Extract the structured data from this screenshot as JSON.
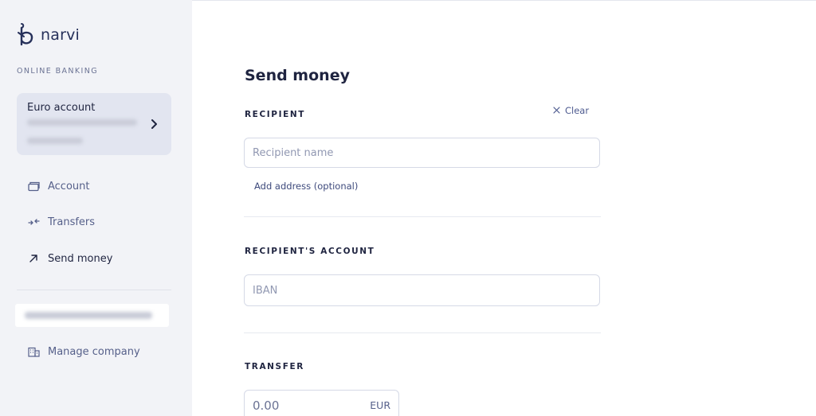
{
  "brand": {
    "name": "narvi"
  },
  "sidebar": {
    "section_label": "ONLINE BANKING",
    "account_card": {
      "name": "Euro account"
    },
    "nav": [
      {
        "label": "Account",
        "icon": "wallet-icon"
      },
      {
        "label": "Transfers",
        "icon": "transfer-arrows-icon"
      },
      {
        "label": "Send money",
        "icon": "arrow-up-right-icon"
      }
    ],
    "manage": {
      "label": "Manage company",
      "icon": "building-icon"
    }
  },
  "main": {
    "title": "Send money",
    "recipient": {
      "label": "RECIPIENT",
      "clear_label": "Clear",
      "name_placeholder": "Recipient name",
      "add_address_label": "Add address (optional)"
    },
    "recipient_account": {
      "label": "RECIPIENT'S ACCOUNT",
      "iban_placeholder": "IBAN"
    },
    "transfer": {
      "label": "TRANSFER",
      "amount_placeholder": "0.00",
      "currency": "EUR"
    }
  },
  "colors": {
    "sidebar_bg": "#f2f3f7",
    "card_bg": "#e2e5f0",
    "text_primary": "#1f2440",
    "text_secondary": "#56608a",
    "accent": "#4d5a8f"
  }
}
